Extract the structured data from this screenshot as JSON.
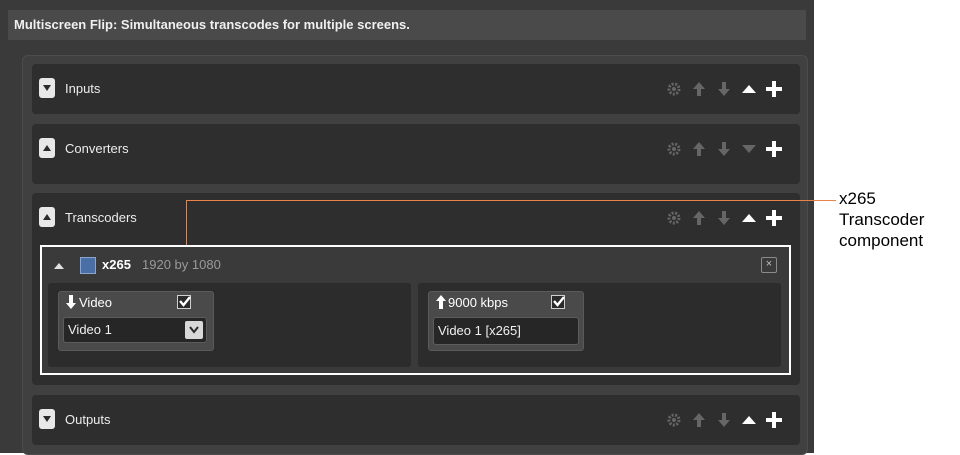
{
  "window": {
    "title": "Multiscreen Flip: Simultaneous transcodes for multiple screens."
  },
  "sections": [
    {
      "label": "Inputs",
      "expanded": false,
      "actions": [
        "gear-icon",
        "arrow-up-icon",
        "arrow-down-icon",
        "collapse-caret-icon",
        "plus-icon"
      ]
    },
    {
      "label": "Converters",
      "expanded": true,
      "actions": [
        "gear-icon",
        "arrow-up-icon",
        "arrow-down-icon",
        "expand-caret-icon",
        "plus-icon"
      ]
    },
    {
      "label": "Transcoders",
      "expanded": true,
      "actions": [
        "gear-icon",
        "arrow-up-icon",
        "arrow-down-icon",
        "collapse-caret-icon",
        "plus-icon"
      ]
    },
    {
      "label": "Outputs",
      "expanded": false,
      "actions": [
        "gear-icon",
        "arrow-up-icon",
        "arrow-down-icon",
        "collapse-caret-icon",
        "plus-icon"
      ]
    }
  ],
  "transcoder": {
    "name": "x265",
    "dimensions": "1920 by 1080",
    "close_label": "×",
    "input_pin": {
      "label": "Video",
      "checked": true,
      "selected": "Video 1"
    },
    "output_pin": {
      "label": "9000 kbps",
      "checked": true,
      "value": "Video 1 [x265]"
    }
  },
  "callout": {
    "line1": "x265",
    "line2": "Transcoder",
    "line3": "component"
  },
  "colors": {
    "background": "#3a3a3a",
    "section": "#2e2e2e",
    "callout_line": "#e8834a",
    "highlight_border": "#ffffff"
  }
}
